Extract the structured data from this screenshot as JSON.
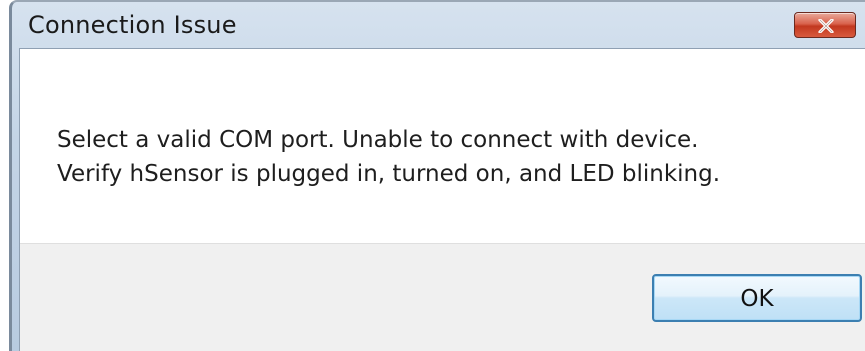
{
  "dialog": {
    "title": "Connection Issue",
    "close_icon": "close-x-icon",
    "message_lines": [
      "Select a valid COM port. Unable to connect with device.",
      "Verify hSensor is plugged in, turned on, and LED blinking."
    ],
    "ok_label": "OK"
  },
  "colors": {
    "titlebar": "#c3d4e6",
    "close_button": "#c2381f",
    "footer": "#f0f0f0",
    "ok_border": "#3c7fb1"
  }
}
